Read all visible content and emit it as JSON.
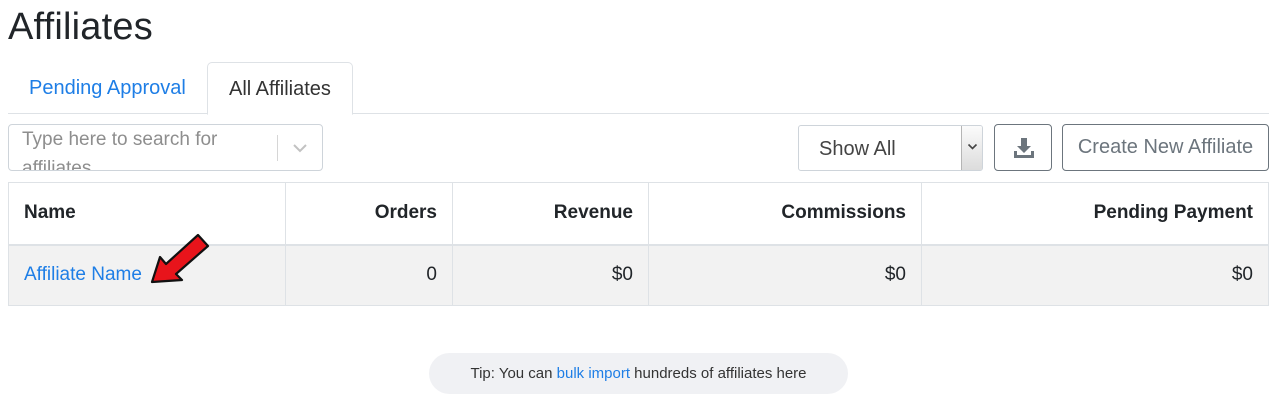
{
  "page": {
    "title": "Affiliates"
  },
  "tabs": [
    {
      "label": "Pending Approval",
      "active": false
    },
    {
      "label": "All Affiliates",
      "active": true
    }
  ],
  "toolbar": {
    "search_placeholder": "Type here to search for affiliates",
    "filter_value": "Show All",
    "download_icon": "download-icon",
    "create_label": "Create New Affiliate"
  },
  "table": {
    "headers": [
      "Name",
      "Orders",
      "Revenue",
      "Commissions",
      "Pending Payment"
    ],
    "rows": [
      {
        "name": "Affiliate Name",
        "orders": "0",
        "revenue": "$0",
        "commissions": "$0",
        "pending": "$0"
      }
    ]
  },
  "annotation": {
    "icon": "red-arrow-icon",
    "color": "#e8141b"
  },
  "tip": {
    "before": "Tip: You can ",
    "link": "bulk import",
    "after": " hundreds of affiliates here"
  },
  "colors": {
    "link": "#1e7ee6",
    "row_bg": "#f2f2f2",
    "tip_bg": "#f0f1f4"
  }
}
